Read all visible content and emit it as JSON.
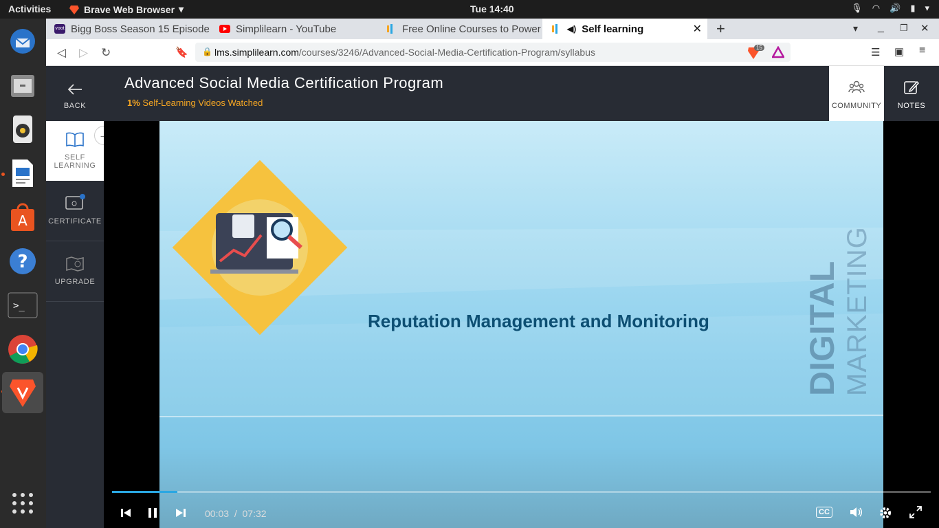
{
  "system": {
    "activities": "Activities",
    "app_name": "Brave Web Browser",
    "clock": "Tue 14:40"
  },
  "tabs": [
    {
      "label": "Bigg Boss Season 15 Episode",
      "fav_text": "voot"
    },
    {
      "label": "Simplilearn - YouTube"
    },
    {
      "label": "Free Online Courses to Power"
    },
    {
      "label": "Self learning"
    }
  ],
  "browser": {
    "url_host": "lms.simplilearn.com",
    "url_path": "/courses/3246/Advanced-Social-Media-Certification-Program/syllabus",
    "shield_count": "15"
  },
  "header": {
    "title": "Advanced Social Media Certification Program",
    "progress_value": "1%",
    "progress_label": "Self-Learning Videos Watched",
    "community": "COMMUNITY",
    "notes": "NOTES"
  },
  "sidebar": {
    "back": "BACK",
    "self_learning_1": "SELF",
    "self_learning_2": "LEARNING",
    "certificate": "CERTIFICATE",
    "upgrade": "UPGRADE"
  },
  "video": {
    "heading": "Reputation Management and Monitoring",
    "vertical_1": "DIGITAL",
    "vertical_2": "MARKETING",
    "current_time": "00:03",
    "separator": "/",
    "duration": "07:32",
    "progress_fraction": 0.08,
    "cc": "CC"
  }
}
